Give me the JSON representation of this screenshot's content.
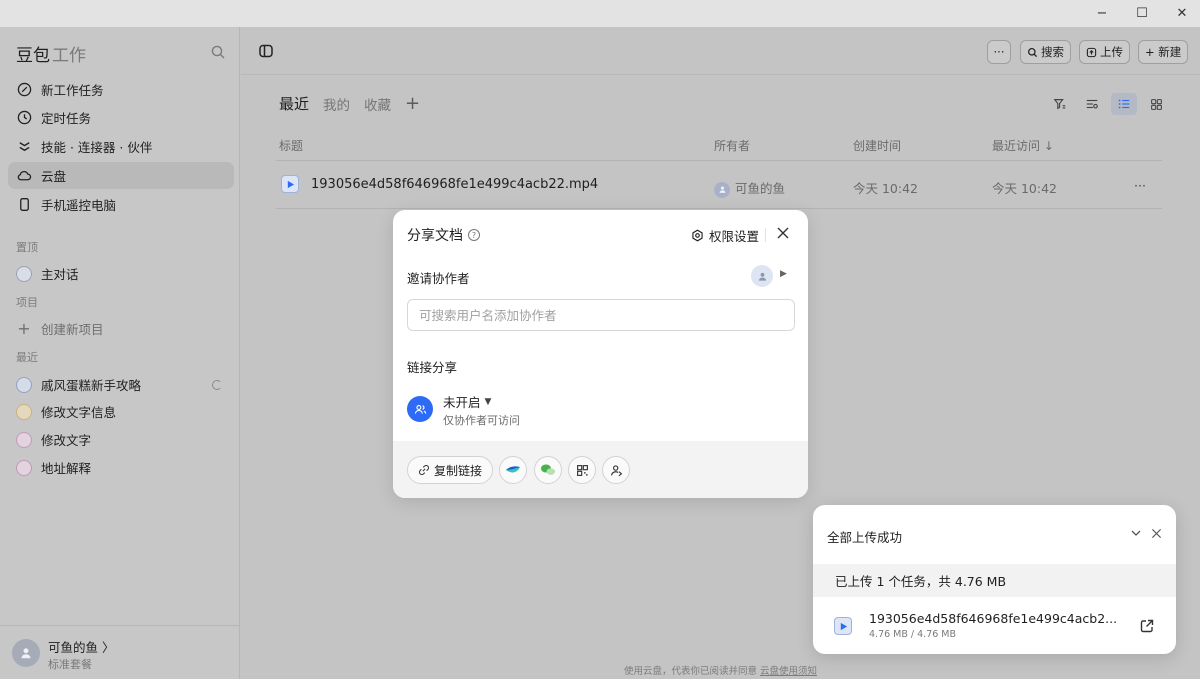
{
  "window": {
    "minimize": "−",
    "maximize": "☐",
    "close": "✕"
  },
  "sidebar": {
    "brand": "豆包",
    "brand_sub": "工作",
    "nav": [
      {
        "label": "新工作任务",
        "icon": "edit-icon"
      },
      {
        "label": "定时任务",
        "icon": "clock-icon"
      },
      {
        "label": "技能 · 连接器 · 伙伴",
        "icon": "skills-icon"
      },
      {
        "label": "云盘",
        "icon": "cloud-icon"
      },
      {
        "label": "手机遥控电脑",
        "icon": "phone-icon"
      }
    ],
    "pinned_label": "置顶",
    "pinned": [
      {
        "label": "主对话"
      }
    ],
    "projects_label": "项目",
    "new_project": "创建新项目",
    "recent_label": "最近",
    "recent": [
      {
        "label": "戚风蛋糕新手攻略"
      },
      {
        "label": "修改文字信息"
      },
      {
        "label": "修改文字"
      },
      {
        "label": "地址解释"
      }
    ],
    "user": {
      "name": "可鱼的鱼 〉",
      "plan": "标准套餐"
    }
  },
  "topbar": {
    "more": "···",
    "search": "搜索",
    "upload": "上传",
    "new": "+ 新建"
  },
  "tabs": [
    "最近",
    "我的",
    "收藏"
  ],
  "table": {
    "headers": {
      "title": "标题",
      "owner": "所有者",
      "created": "创建时间",
      "accessed": "最近访问 ↓"
    },
    "rows": [
      {
        "name": "193056e4d58f646968fe1e499c4acb22.mp4",
        "owner": "可鱼的鱼",
        "created": "今天 10:42",
        "accessed": "今天 10:42",
        "more": "···"
      }
    ]
  },
  "footer": {
    "text": "使用云盘，代表你已阅读并同意",
    "link": "云盘使用须知"
  },
  "share_dialog": {
    "title": "分享文档",
    "help": "?",
    "permission_settings": "权限设置",
    "invite_label": "邀请协作者",
    "search_placeholder": "可搜索用户名添加协作者",
    "link_share_label": "链接分享",
    "link_status": "未开启",
    "link_status_sub": "仅协作者可访问",
    "copy_link": "复制链接"
  },
  "upload_toast": {
    "title": "全部上传成功",
    "summary": "已上传 1 个任务，共 4.76 MB",
    "file_name": "193056e4d58f646968fe1e499c4acb2...",
    "file_size": "4.76 MB / 4.76 MB"
  },
  "colors": {
    "accent": "#2d6bf6",
    "sidebar_bg": "#c7c7c7",
    "overlay_bg": "#c4c4c4"
  }
}
